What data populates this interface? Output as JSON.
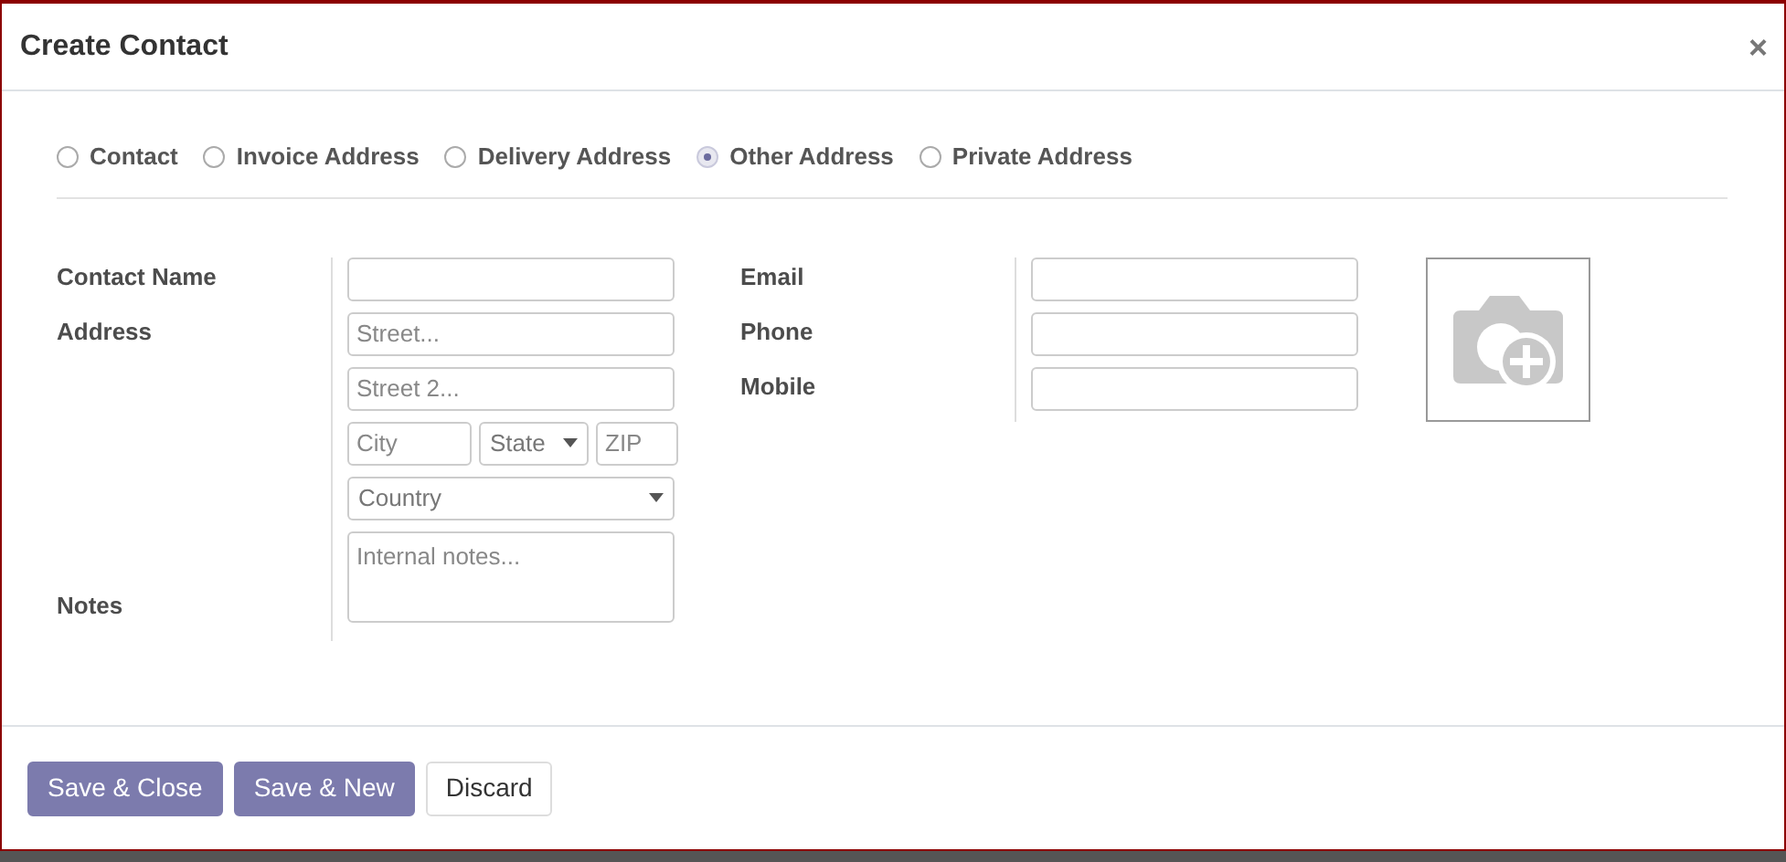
{
  "dialog": {
    "title": "Create Contact",
    "close": "×"
  },
  "address_types": [
    {
      "label": "Contact",
      "selected": false
    },
    {
      "label": "Invoice Address",
      "selected": false
    },
    {
      "label": "Delivery Address",
      "selected": false
    },
    {
      "label": "Other Address",
      "selected": true
    },
    {
      "label": "Private Address",
      "selected": false
    }
  ],
  "contact_name": {
    "label": "Contact Name"
  },
  "address": {
    "label": "Address",
    "street": {
      "placeholder": "Street..."
    },
    "street2": {
      "placeholder": "Street 2..."
    },
    "city": {
      "placeholder": "City"
    },
    "state": {
      "placeholder": "State"
    },
    "zip": {
      "placeholder": "ZIP"
    },
    "country": {
      "placeholder": "Country"
    }
  },
  "notes": {
    "label": "Notes",
    "placeholder": "Internal notes..."
  },
  "contact_fields": [
    {
      "label": "Email"
    },
    {
      "label": "Phone"
    },
    {
      "label": "Mobile"
    }
  ],
  "buttons": [
    {
      "label": "Save & Close",
      "kind": "primary"
    },
    {
      "label": "Save & New",
      "kind": "primary"
    },
    {
      "label": "Discard",
      "kind": "secondary"
    }
  ]
}
